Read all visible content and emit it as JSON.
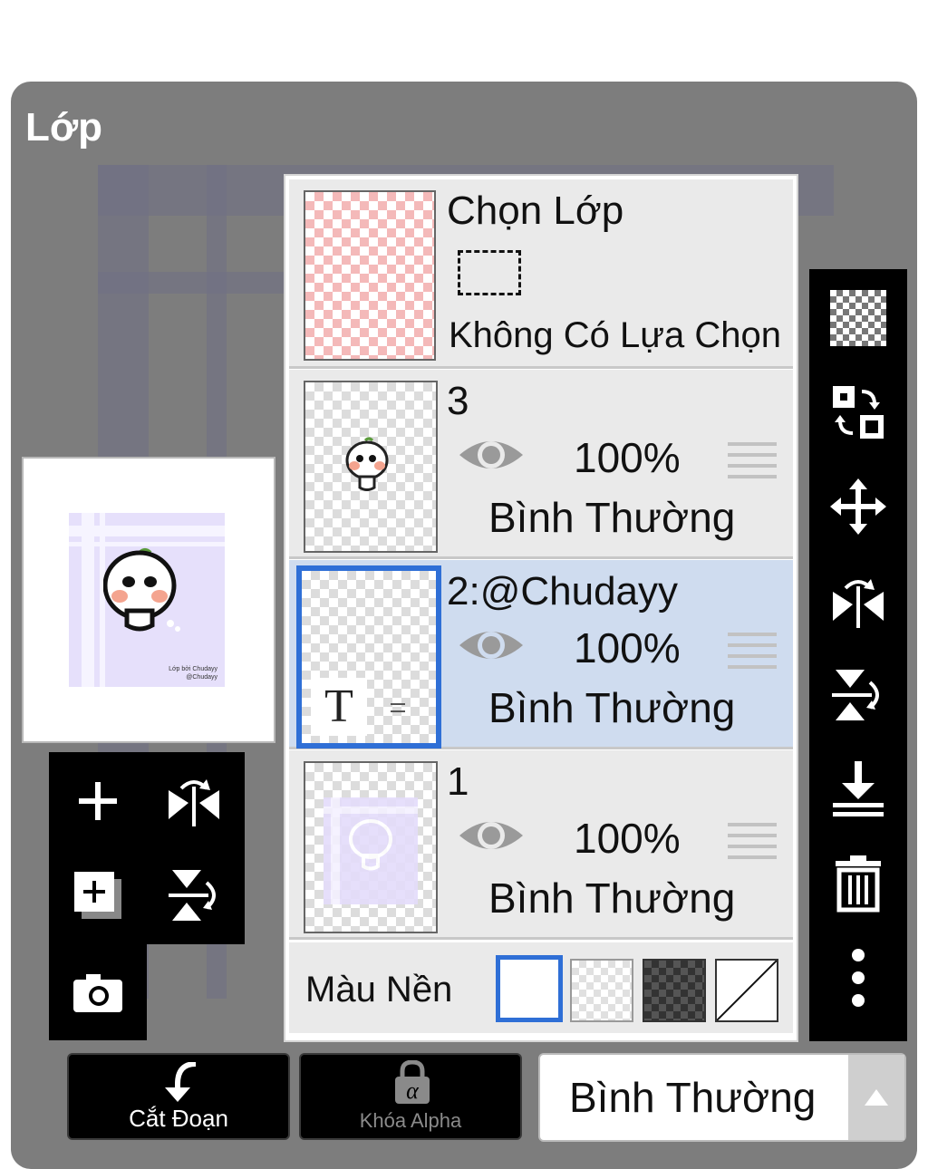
{
  "dialog": {
    "title": "Lớp"
  },
  "preview": {
    "caption_line1": "Lớp bởi Chudayy",
    "caption_line2": "@Chudayy"
  },
  "selection_layer": {
    "name": "Chọn Lớp",
    "status": "Không Có Lựa Chọn"
  },
  "layers": [
    {
      "name": "3",
      "opacity": "100%",
      "blend": "Bình Thường",
      "selected": false
    },
    {
      "name": "2:@Chudayy",
      "opacity": "100%",
      "blend": "Bình Thường",
      "selected": true,
      "type_icon": "T"
    },
    {
      "name": "1",
      "opacity": "100%",
      "blend": "Bình Thường",
      "selected": false
    }
  ],
  "background_color": {
    "label": "Màu Nền",
    "options": [
      "white",
      "transparent",
      "dark-checker",
      "none"
    ],
    "selected": "white"
  },
  "bottom_bar": {
    "clip_label": "Cắt Đoạn",
    "alpha_lock_label": "Khóa Alpha",
    "blend_mode_value": "Bình Thường"
  },
  "colors": {
    "selected_border": "#2f6fd6",
    "selected_row": "#cfdcef",
    "panel_bg": "#7d7d7d"
  }
}
